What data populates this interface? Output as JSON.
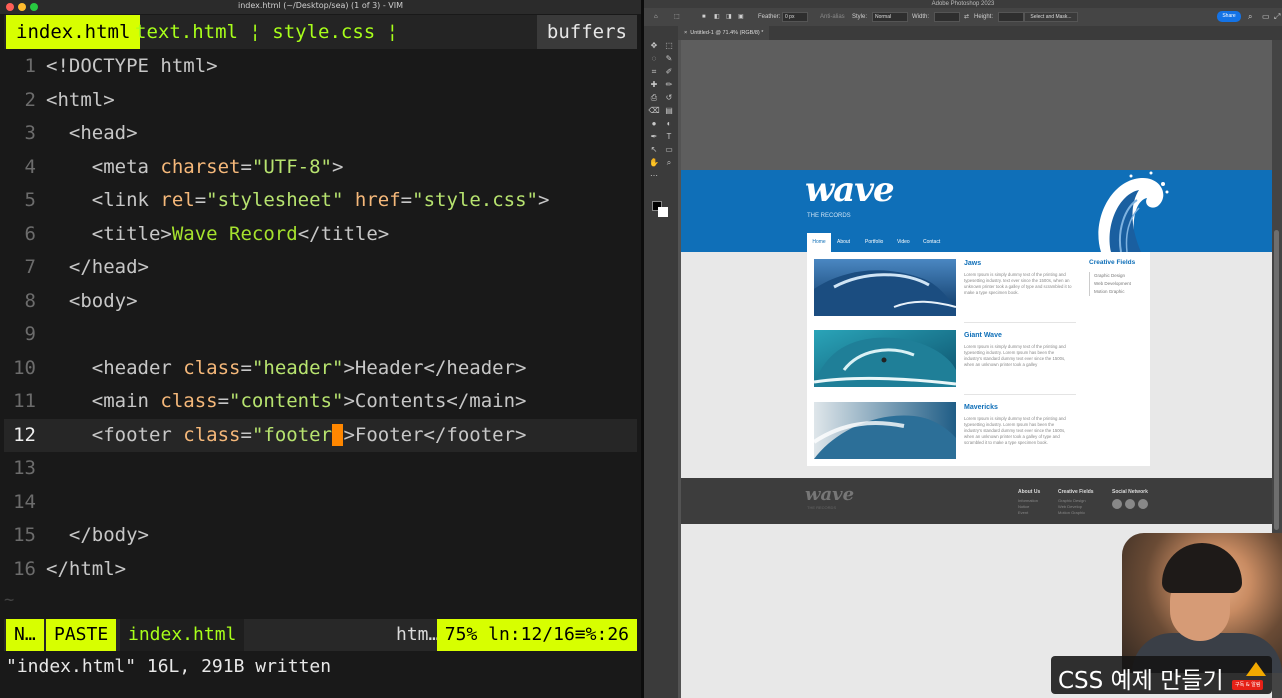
{
  "vim": {
    "window_title": "index.html (~/Desktop/sea) (1 of 3) - VIM",
    "tabs": {
      "active": "index.html",
      "others": "text.html ¦ style.css ¦",
      "buffers": "buffers"
    },
    "lines": [
      {
        "n": "1",
        "segments": [
          {
            "t": "<!DOCTYPE html>",
            "c": "t-tag"
          }
        ]
      },
      {
        "n": "2",
        "segments": [
          {
            "t": "<html>",
            "c": "t-tag"
          }
        ]
      },
      {
        "n": "3",
        "segments": [
          {
            "t": "  <head>",
            "c": "t-tag"
          }
        ]
      },
      {
        "n": "4",
        "segments": [
          {
            "t": "    <meta ",
            "c": "t-tag"
          },
          {
            "t": "charset",
            "c": "t-attr"
          },
          {
            "t": "=",
            "c": "t-tag"
          },
          {
            "t": "\"UTF-8\"",
            "c": "t-str"
          },
          {
            "t": ">",
            "c": "t-tag"
          }
        ]
      },
      {
        "n": "5",
        "segments": [
          {
            "t": "    <link ",
            "c": "t-tag"
          },
          {
            "t": "rel",
            "c": "t-attr"
          },
          {
            "t": "=",
            "c": "t-tag"
          },
          {
            "t": "\"stylesheet\"",
            "c": "t-str"
          },
          {
            "t": " ",
            "c": "t-tag"
          },
          {
            "t": "href",
            "c": "t-attr"
          },
          {
            "t": "=",
            "c": "t-tag"
          },
          {
            "t": "\"style.css\"",
            "c": "t-str"
          },
          {
            "t": ">",
            "c": "t-tag"
          }
        ]
      },
      {
        "n": "6",
        "segments": [
          {
            "t": "    <title>",
            "c": "t-tag"
          },
          {
            "t": "Wave Record",
            "c": "t-title"
          },
          {
            "t": "</title>",
            "c": "t-tag"
          }
        ]
      },
      {
        "n": "7",
        "segments": [
          {
            "t": "  </head>",
            "c": "t-tag"
          }
        ]
      },
      {
        "n": "8",
        "segments": [
          {
            "t": "  <body>",
            "c": "t-tag"
          }
        ]
      },
      {
        "n": "9",
        "segments": []
      },
      {
        "n": "10",
        "segments": [
          {
            "t": "    <header ",
            "c": "t-tag"
          },
          {
            "t": "class",
            "c": "t-attr"
          },
          {
            "t": "=",
            "c": "t-tag"
          },
          {
            "t": "\"header\"",
            "c": "t-str"
          },
          {
            "t": ">Header</header>",
            "c": "t-tag"
          }
        ]
      },
      {
        "n": "11",
        "segments": [
          {
            "t": "    <main ",
            "c": "t-tag"
          },
          {
            "t": "class",
            "c": "t-attr"
          },
          {
            "t": "=",
            "c": "t-tag"
          },
          {
            "t": "\"contents\"",
            "c": "t-str"
          },
          {
            "t": ">Contents</main>",
            "c": "t-tag"
          }
        ]
      },
      {
        "n": "12",
        "current": true,
        "segments": [
          {
            "t": "    <footer ",
            "c": "t-tag"
          },
          {
            "t": "class",
            "c": "t-attr"
          },
          {
            "t": "=",
            "c": "t-tag"
          },
          {
            "t": "\"footer",
            "c": "t-str"
          },
          {
            "t": "\"",
            "c": "cursor"
          },
          {
            "t": ">Footer</footer>",
            "c": "t-tag"
          }
        ]
      },
      {
        "n": "13",
        "segments": []
      },
      {
        "n": "14",
        "segments": []
      },
      {
        "n": "15",
        "segments": [
          {
            "t": "  </body>",
            "c": "t-tag"
          }
        ]
      },
      {
        "n": "16",
        "segments": [
          {
            "t": "</html>",
            "c": "t-tag"
          }
        ]
      }
    ],
    "tilde": "~",
    "statusline": {
      "mode": "N…",
      "paste": "PASTE",
      "file": "index.html",
      "filetype": "htm…",
      "position": "75%  ln:12/16≡%:26"
    },
    "cmdline": "\"index.html\" 16L, 291B written"
  },
  "photoshop": {
    "app_title": "Adobe Photoshop 2023",
    "options": {
      "feather_label": "Feather:",
      "feather_value": "0 px",
      "antialias_label": "Anti-alias",
      "style_label": "Style:",
      "style_value": "Normal",
      "width_label": "Width:",
      "height_label": "Height:",
      "select_mask": "Select and Mask...",
      "share": "Share"
    },
    "doc_tab": "×  Untitled-1 @ 71.4% (RGB/8) *",
    "tools": [
      "move-tool",
      "marquee-tool",
      "lasso-tool",
      "quick-select-tool",
      "crop-tool",
      "eyedropper-tool",
      "healing-tool",
      "brush-tool",
      "stamp-tool",
      "history-brush-tool",
      "eraser-tool",
      "gradient-tool",
      "blur-tool",
      "dodge-tool",
      "pen-tool",
      "type-tool",
      "path-select-tool",
      "rectangle-tool",
      "hand-tool",
      "zoom-tool",
      "more-tools"
    ],
    "mockup": {
      "logo": "wave",
      "sub": "THE RECORDS",
      "nav": [
        "Home",
        "About",
        "Portfolio",
        "Video",
        "Contact Us"
      ],
      "posts": [
        {
          "title": "Jaws",
          "text": "Lorem Ipsum is simply dummy text of the printing and typesetting industry. text ever since the 1500s, when an unknown printer took a galley of type and scrambled it to make a type specimen book."
        },
        {
          "title": "Giant Wave",
          "text": "Lorem Ipsum is simply dummy text of the printing and typesetting industry. Lorem Ipsum has been the industry's standard dummy text ever since the 1500s, when an unknown printer took a galley"
        },
        {
          "title": "Mavericks",
          "text": "Lorem Ipsum is simply dummy text of the printing and typesetting industry. Lorem Ipsum has been the industry's standard dummy text ever since the 1500s, when an unknown printer took a galley of type and scrambled it to make a type specimen book."
        }
      ],
      "side_title": "Creative Fields",
      "side_items": [
        "Graphic Design",
        "Web Development",
        "Motion Graphic"
      ],
      "footer": {
        "logo": "wave",
        "sub": "THE RECORDS",
        "col1_title": "About Us",
        "col1_items": [
          "Information",
          "Notice",
          "Event"
        ],
        "col2_title": "Creative Fields",
        "col2_items": [
          "Graphic Design",
          "Web Develop",
          "Motion Graphic"
        ],
        "col3_title": "Social Network"
      }
    }
  },
  "overlay": {
    "caption": "CSS 예제 만들기",
    "subscribe": "구독 & 알림"
  }
}
